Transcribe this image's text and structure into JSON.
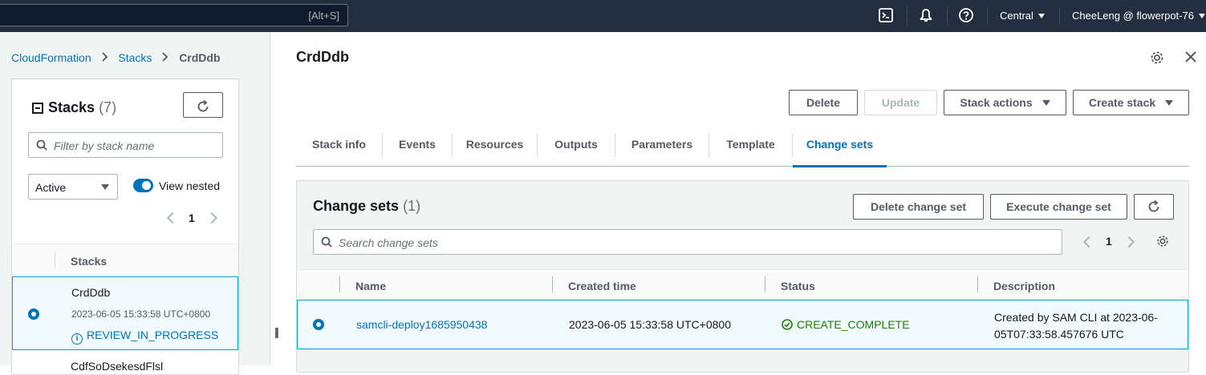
{
  "topnav": {
    "search_shortcut": "[Alt+S]",
    "icons": [
      "cloudshell-icon",
      "notifications-icon",
      "help-icon"
    ],
    "region": "Central",
    "account": "CheeLeng @ flowerpot-76"
  },
  "breadcrumb": {
    "items": [
      "CloudFormation",
      "Stacks"
    ],
    "current": "CrdDdb"
  },
  "stacks_panel": {
    "title": "Stacks",
    "count": "(7)",
    "filter_placeholder": "Filter by stack name",
    "status_filter": "Active",
    "view_nested_label": "View nested",
    "page": "1",
    "column_header": "Stacks",
    "rows": [
      {
        "name": "CrdDdb",
        "created": "2023-06-05 15:33:58 UTC+0800",
        "status": "REVIEW_IN_PROGRESS"
      }
    ],
    "next_row_partial": "CdfSoDsekesdFlsl"
  },
  "detail": {
    "title": "CrdDdb",
    "actions": {
      "delete": "Delete",
      "update": "Update",
      "stack_actions": "Stack actions",
      "create_stack": "Create stack"
    },
    "tabs": [
      "Stack info",
      "Events",
      "Resources",
      "Outputs",
      "Parameters",
      "Template",
      "Change sets"
    ],
    "active_tab": "Change sets"
  },
  "change_sets": {
    "title": "Change sets",
    "count": "(1)",
    "delete_button": "Delete change set",
    "execute_button": "Execute change set",
    "search_placeholder": "Search change sets",
    "page": "1",
    "columns": [
      "Name",
      "Created time",
      "Status",
      "Description"
    ],
    "rows": [
      {
        "name": "samcli-deploy1685950438",
        "created": "2023-06-05 15:33:58 UTC+0800",
        "status": "CREATE_COMPLETE",
        "description_line1": "Created by SAM CLI at 2023-06-",
        "description_line2": "05T07:33:58.457676 UTC"
      }
    ]
  },
  "colors": {
    "nav_bg": "#232f3e",
    "link": "#0073bb",
    "success": "#1d8102",
    "selected_row_bg": "#f1faff",
    "selected_row_border": "#00a1c9"
  }
}
